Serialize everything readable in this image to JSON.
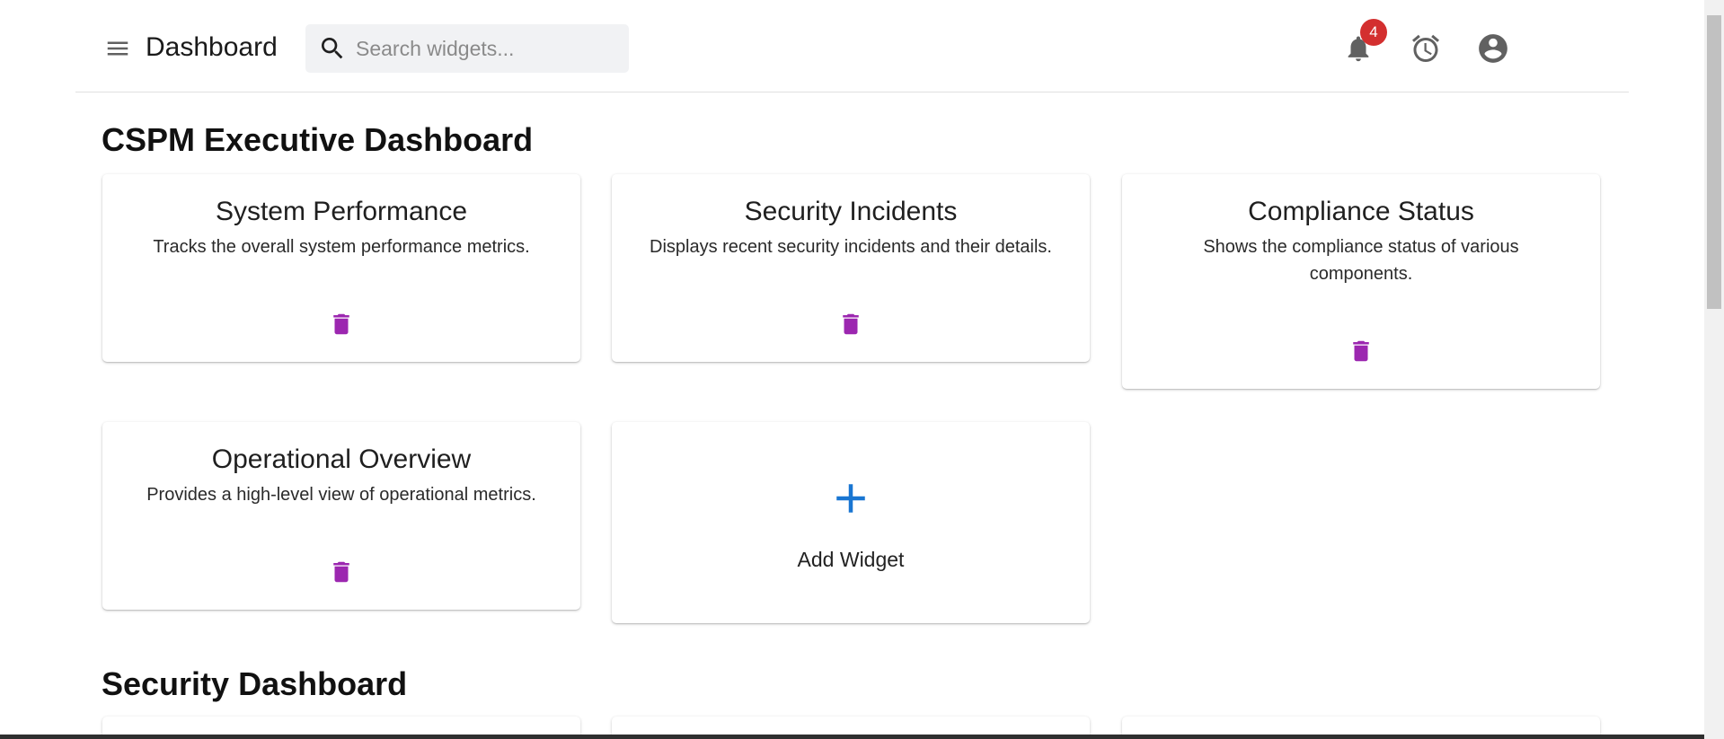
{
  "header": {
    "title": "Dashboard",
    "search_placeholder": "Search widgets...",
    "search_value": "",
    "notification_count": "4",
    "icons": {
      "menu": "menu-icon",
      "search": "search-icon",
      "notifications": "bell-icon",
      "alarm": "alarm-icon",
      "account": "account-icon"
    }
  },
  "sections": [
    {
      "title": "CSPM Executive Dashboard",
      "widgets": [
        {
          "title": "System Performance",
          "description": "Tracks the overall system performance metrics."
        },
        {
          "title": "Security Incidents",
          "description": "Displays recent security incidents and their details."
        },
        {
          "title": "Compliance Status",
          "description": "Shows the compliance status of various components."
        },
        {
          "title": "Operational Overview",
          "description": "Provides a high-level view of operational metrics."
        }
      ],
      "add_widget_label": "Add Widget"
    },
    {
      "title": "Security Dashboard"
    }
  ],
  "colors": {
    "delete_icon": "#9c27b0",
    "add_icon": "#1976d2",
    "badge": "#d32f2f",
    "icon_gray": "#616161"
  }
}
